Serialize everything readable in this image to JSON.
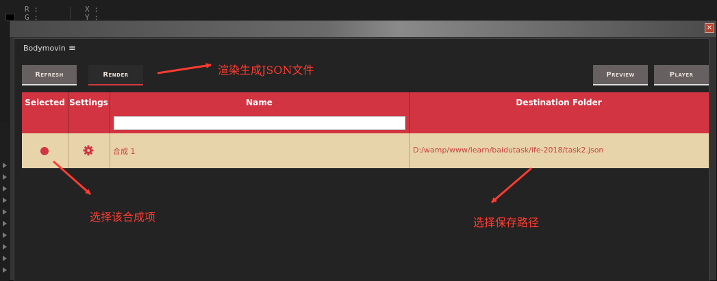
{
  "host": {
    "readouts": [
      "R :",
      "G :",
      "X :",
      "Y :"
    ]
  },
  "window": {
    "close_glyph": "×"
  },
  "panel": {
    "tab_label": "Bodymovin",
    "menu_glyph": "≡"
  },
  "toolbar": {
    "refresh": "Refresh",
    "render": "Render",
    "preview": "Preview",
    "player": "Player"
  },
  "table": {
    "headers": [
      "Selected",
      "Settings",
      "Name",
      "Destination Folder"
    ],
    "name_filter_value": "",
    "rows": [
      {
        "selected": true,
        "settings_icon": "gear-icon",
        "name": "合成 1",
        "destination": "D:/wamp/www/learn/baidutask/ife-2018/task2.json"
      }
    ]
  },
  "annotations": {
    "render_note": "渲染生成JSON文件",
    "select_note": "选择该合成项",
    "path_note": "选择保存路径"
  },
  "colors": {
    "accent_red": "#d23441",
    "row_bg": "#e8d4ab",
    "annotation_red": "#ff3b30"
  }
}
